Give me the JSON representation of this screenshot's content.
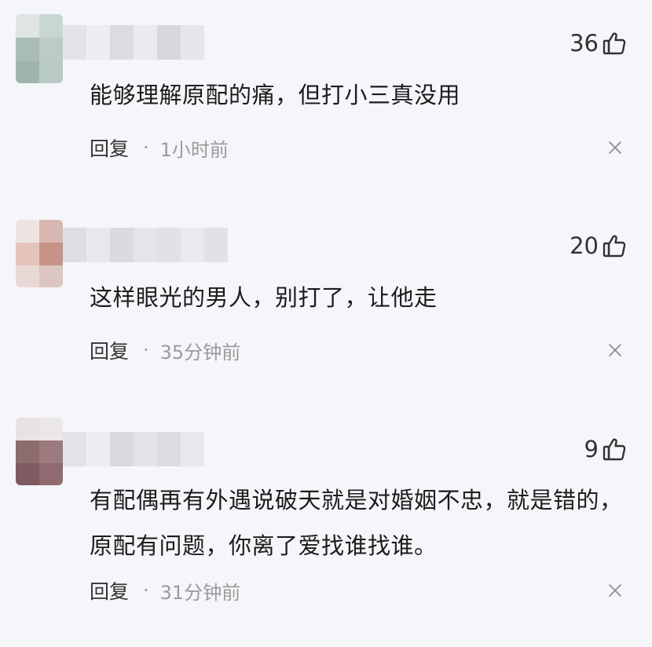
{
  "comments": [
    {
      "likes": "36",
      "text": "能够理解原配的痛，但打小三真没用",
      "reply_label": "回复",
      "separator": "·",
      "time": "1小时前"
    },
    {
      "likes": "20",
      "text": "这样眼光的男人，别打了，让他走",
      "reply_label": "回复",
      "separator": "·",
      "time": "35分钟前"
    },
    {
      "likes": "9",
      "text": "有配偶再有外遇说破天就是对婚姻不忠，就是错的，原配有问题，你离了爱找谁找谁。",
      "reply_label": "回复",
      "separator": "·",
      "time": "31分钟前"
    }
  ],
  "icons": {
    "like": "thumbs-up-icon",
    "close": "close-icon"
  },
  "colors": {
    "background": "#f5f6fa",
    "text": "#1c1c1c",
    "meta": "#9a9a9a"
  }
}
